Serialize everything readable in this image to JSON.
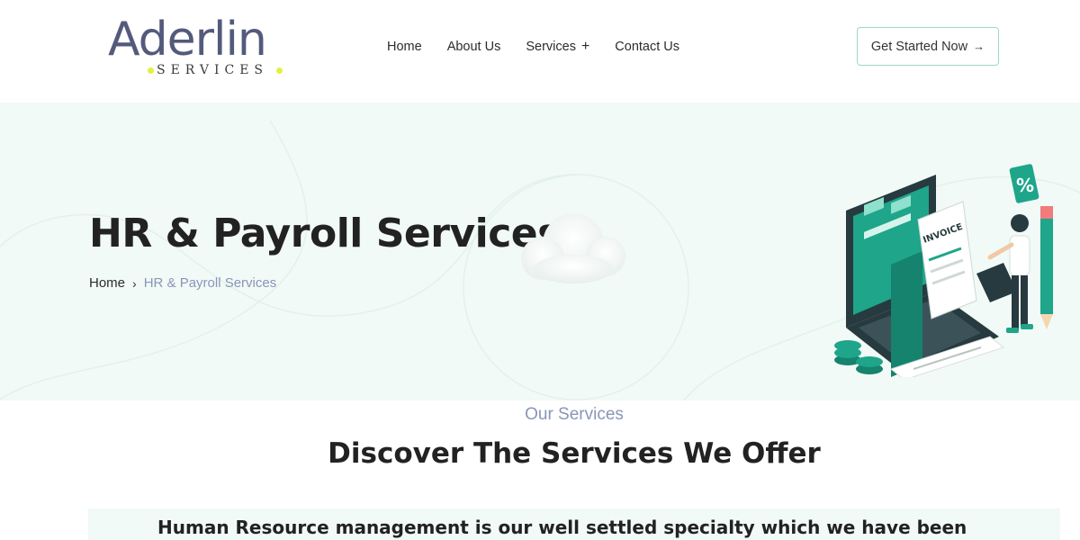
{
  "brand": {
    "name": "Aderlin",
    "tagline": "SERVICES",
    "colors": {
      "logo": "#545a7c",
      "dot": "#e7ef3d",
      "accent": "#1ea58a",
      "hero_bg": "#f1faf6"
    }
  },
  "nav": {
    "items": [
      {
        "label": "Home"
      },
      {
        "label": "About Us"
      },
      {
        "label": "Services",
        "has_submenu": true,
        "submenu_icon": "+"
      },
      {
        "label": "Contact Us"
      }
    ],
    "cta_label": "Get Started Now",
    "cta_icon": "→"
  },
  "hero": {
    "title": "HR & Payroll Services",
    "breadcrumb": {
      "home": "Home",
      "separator": "›",
      "current": "HR & Payroll Services"
    },
    "illustration": {
      "invoice_label": "INVOICE",
      "badge_icon": "%"
    }
  },
  "services": {
    "eyebrow": "Our Services",
    "title": "Discover The Services We Offer",
    "intro": "Human Resource management is our well settled specialty which we have been"
  }
}
